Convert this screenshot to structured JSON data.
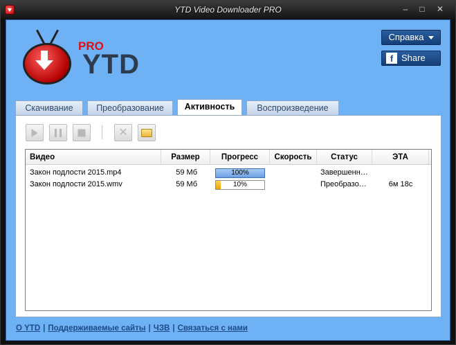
{
  "window": {
    "title": "YTD Video Downloader PRO",
    "min": "‒",
    "max": "□",
    "close": "✕"
  },
  "logo": {
    "pro": "PRO",
    "ytd": "YTD"
  },
  "header": {
    "help_label": "Справка",
    "share_label": "Share",
    "fb_letter": "f"
  },
  "tabs": [
    {
      "label": "Скачивание"
    },
    {
      "label": "Преобразование"
    },
    {
      "label": "Активность"
    },
    {
      "label": "Воспроизведение"
    }
  ],
  "active_tab": "Активность",
  "toolbar": {
    "delete_glyph": "✕"
  },
  "table": {
    "headers": {
      "video": "Видео",
      "size": "Размер",
      "progress": "Прогресс",
      "speed": "Скорость",
      "status": "Статус",
      "eta": "ЭТА"
    },
    "rows": [
      {
        "video": "Закон подлости 2015.mp4",
        "size": "59 Мб",
        "progress": 100,
        "progress_label": "100%",
        "speed": "",
        "status": "Завершенн…",
        "eta": ""
      },
      {
        "video": "Закон подлости 2015.wmv",
        "size": "59 Мб",
        "progress": 10,
        "progress_label": "10%",
        "speed": "",
        "status": "Преобразо…",
        "eta": "6м 18с"
      }
    ]
  },
  "footer": {
    "links": [
      "О YTD",
      "Поддерживаемые сайты",
      "ЧЗВ",
      "Связаться с нами"
    ],
    "separator": "|"
  },
  "colors": {
    "client_bg": "#6fb1f5",
    "button_blue": "#1b4f92",
    "progress_done": "#6b9fe2",
    "progress_active": "#e9a400"
  }
}
